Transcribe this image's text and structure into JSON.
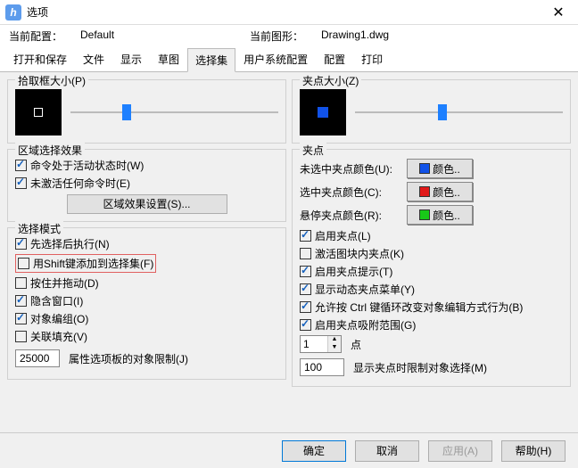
{
  "window": {
    "title": "选项",
    "close": "✕"
  },
  "header": {
    "config_label": "当前配置：",
    "config_value": "Default",
    "drawing_label": "当前图形：",
    "drawing_value": "Drawing1.dwg"
  },
  "tabs": [
    "打开和保存",
    "文件",
    "显示",
    "草图",
    "选择集",
    "用户系统配置",
    "配置",
    "打印"
  ],
  "active_tab": 4,
  "left": {
    "pickbox_legend": "拾取框大小(P)",
    "region_legend": "区域选择效果",
    "region_chk1": "命令处于活动状态时(W)",
    "region_chk2": "未激活任何命令时(E)",
    "region_btn": "区域效果设置(S)...",
    "mode_legend": "选择模式",
    "mode_items": [
      "先选择后执行(N)",
      "用Shift键添加到选择集(F)",
      "按住并拖动(D)",
      "隐含窗口(I)",
      "对象编组(O)",
      "关联填充(V)"
    ],
    "mode_checked": [
      true,
      false,
      false,
      true,
      true,
      false
    ],
    "limit_value": "25000",
    "limit_label": "属性选项板的对象限制(J)"
  },
  "right": {
    "gripsize_legend": "夹点大小(Z)",
    "grip_legend": "夹点",
    "color_rows": [
      {
        "label": "未选中夹点颜色(U):",
        "hex": "#1152e8"
      },
      {
        "label": "选中夹点颜色(C):",
        "hex": "#e01818"
      },
      {
        "label": "悬停夹点颜色(R):",
        "hex": "#18c818"
      }
    ],
    "color_btn_text": "颜色..",
    "grip_chks": [
      {
        "label": "启用夹点(L)",
        "on": true
      },
      {
        "label": "激活图块内夹点(K)",
        "on": false
      },
      {
        "label": "启用夹点提示(T)",
        "on": true
      },
      {
        "label": "显示动态夹点菜单(Y)",
        "on": true
      },
      {
        "label": "允许按 Ctrl 键循环改变对象编辑方式行为(B)",
        "on": true
      },
      {
        "label": "启用夹点吸附范围(G)",
        "on": true
      }
    ],
    "spin_value": "1",
    "spin_label": "点",
    "num_value": "100",
    "num_label": "显示夹点时限制对象选择(M)"
  },
  "footer": {
    "ok": "确定",
    "cancel": "取消",
    "apply": "应用(A)",
    "help": "帮助(H)"
  }
}
